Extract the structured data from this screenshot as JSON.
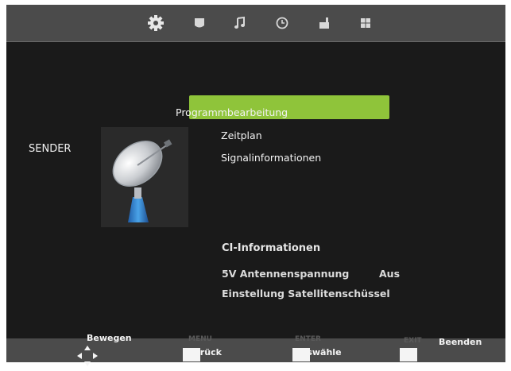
{
  "tabs": [
    {
      "icon": "gear-icon",
      "active": true
    },
    {
      "icon": "picture-icon"
    },
    {
      "icon": "music-note-icon"
    },
    {
      "icon": "clock-icon"
    },
    {
      "icon": "lock-icon"
    },
    {
      "icon": "grid-icon"
    }
  ],
  "category": {
    "label": "SENDER",
    "icon": "satellite-dish-icon"
  },
  "menu": {
    "items": [
      {
        "label": "Programmbearbeitung",
        "selected": true
      },
      {
        "label": "Zeitplan"
      },
      {
        "label": "Signalinformationen"
      }
    ],
    "highlight_color": "#8fc43a"
  },
  "ci_section": {
    "label": "CI-Informationen"
  },
  "settings": [
    {
      "label": "5V Antennenspannung",
      "value": "Aus"
    },
    {
      "label": "Einstellung Satellitenschüssel"
    }
  ],
  "footer": {
    "move": {
      "label": "Bewegen",
      "icon": "dpad-icon"
    },
    "back": {
      "key": "MENU",
      "label": "Zurück"
    },
    "select": {
      "key": "ENTER",
      "label": "Auswähle"
    },
    "exit": {
      "key": "EXIT",
      "label": "Beenden"
    }
  }
}
